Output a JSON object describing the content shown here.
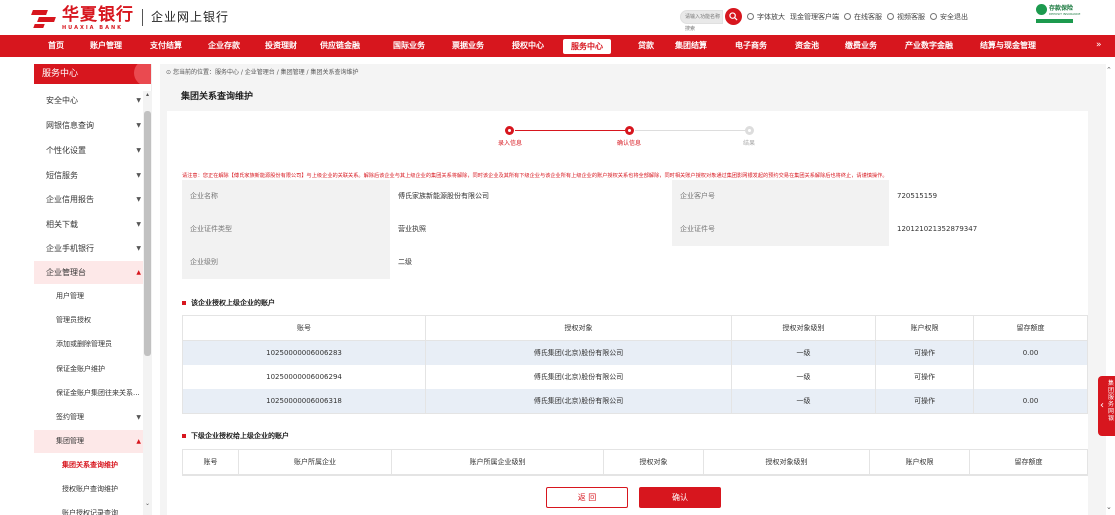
{
  "header": {
    "bank_name": "华夏银行",
    "bank_name_en": "HUAXIA BANK",
    "site_name": "企业网上银行",
    "search_placeholder": "请输入功能名称搜索",
    "links": [
      "字体放大",
      "现金管理客户端",
      "在线客服",
      "视频客服",
      "安全退出"
    ],
    "partner_logo_text": "存款保险",
    "partner_logo_sub": "DEPOSIT INSURANCE"
  },
  "nav": {
    "items": [
      "首页",
      "账户管理",
      "支付结算",
      "企业存款",
      "投资理财",
      "供应链金融",
      "国际业务",
      "票据业务",
      "授权中心",
      "服务中心",
      "贷款",
      "集团结算",
      "电子商务",
      "资金池",
      "缴费业务",
      "产业数字金融",
      "结算与现金管理"
    ],
    "active": "服务中心",
    "more_glyph": "»"
  },
  "sidebar": {
    "title": "服务中心",
    "items": [
      {
        "label": "安全中心",
        "arrow": "▼"
      },
      {
        "label": "网银信息查询",
        "arrow": "▼"
      },
      {
        "label": "个性化设置",
        "arrow": "▼"
      },
      {
        "label": "短信服务",
        "arrow": "▼"
      },
      {
        "label": "企业信用报告",
        "arrow": "▼"
      },
      {
        "label": "相关下载",
        "arrow": "▼"
      },
      {
        "label": "企业手机银行",
        "arrow": "▼"
      },
      {
        "label": "企业管理台",
        "arrow": "▲"
      },
      {
        "label": "用户管理",
        "arrow": ""
      },
      {
        "label": "管理员授权",
        "arrow": ""
      },
      {
        "label": "添加或删除管理员",
        "arrow": ""
      },
      {
        "label": "保证金账户维护",
        "arrow": ""
      },
      {
        "label": "保证金账户集团往来关系...",
        "arrow": ""
      },
      {
        "label": "签约管理",
        "arrow": "▼"
      },
      {
        "label": "集团管理",
        "arrow": "▲"
      },
      {
        "label": "集团关系查询维护",
        "arrow": ""
      },
      {
        "label": "授权账户查询维护",
        "arrow": ""
      },
      {
        "label": "账户授权记录查询",
        "arrow": ""
      }
    ]
  },
  "content": {
    "breadcrumb": "您当前的位置：服务中心 / 企业管理台 / 集团管理 / 集团关系查询维护",
    "title": "集团关系查询维护",
    "steps": [
      {
        "label": "录入信息",
        "state": "done"
      },
      {
        "label": "确认信息",
        "state": "done"
      },
      {
        "label": "结果",
        "state": "todo"
      }
    ],
    "notice": "请注意：您正在解除【傅氏家族新能源股份有限公司】与上级企业的关联关系。解除后该企业与其上级企业的集团关系将解除，同时该企业及其所有下级企业与该企业所有上级企业的账户授权关系也将全部解除，同时相关账户授权对象通过集团影网银发起的预约交易在集团关系解除后也将终止，请谨慎操作。",
    "info": {
      "company_name_label": "企业名称",
      "company_name": "傅氏家族新能源股份有限公司",
      "customer_no_label": "企业客户号",
      "customer_no": "720515159",
      "cert_type_label": "企业证件类型",
      "cert_type": "营业执照",
      "cert_no_label": "企业证件号",
      "cert_no": "120121021352879347",
      "level_label": "企业级别",
      "level": "二级"
    },
    "upper_table": {
      "title": "该企业授权上级企业的账户",
      "headers": [
        "账号",
        "授权对象",
        "授权对象级别",
        "账户权限",
        "留存额度"
      ],
      "rows": [
        [
          "10250000006006283",
          "傅氏集团(北京)股份有限公司",
          "一级",
          "可操作",
          "0.00"
        ],
        [
          "10250000006006294",
          "傅氏集团(北京)股份有限公司",
          "一级",
          "可操作",
          ""
        ],
        [
          "10250000006006318",
          "傅氏集团(北京)股份有限公司",
          "一级",
          "可操作",
          "0.00"
        ]
      ]
    },
    "lower_table": {
      "title": "下级企业授权给上级企业的账户",
      "headers": [
        "账号",
        "账户所属企业",
        "账户所属企业级别",
        "授权对象",
        "授权对象级别",
        "账户权限",
        "留存额度"
      ]
    },
    "buttons": {
      "back": "返 回",
      "confirm": "确认"
    }
  },
  "float_tab": {
    "label": "集团服务网银"
  },
  "colors": {
    "brand_red": "#d7161e",
    "row_alt": "#e8eef6",
    "label_bg": "#f2f2f2"
  }
}
